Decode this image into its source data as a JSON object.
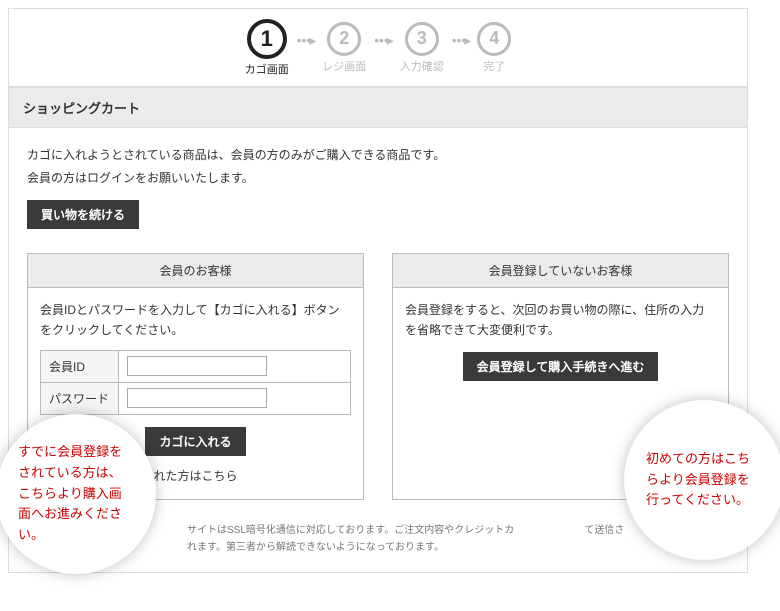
{
  "steps": {
    "s1": {
      "num": "1",
      "label": "カゴ画面"
    },
    "s2": {
      "num": "2",
      "label": "レジ画面"
    },
    "s3": {
      "num": "3",
      "label": "入力確認"
    },
    "s4": {
      "num": "4",
      "label": "完了"
    }
  },
  "page_title": "ショッピングカート",
  "notice_line1": "カゴに入れようとされている商品は、会員の方のみがご購入できる商品です。",
  "notice_line2": "会員の方はログインをお願いいたします。",
  "continue_shopping": "買い物を続ける",
  "member_box": {
    "header": "会員のお客様",
    "desc": "会員IDとパスワードを入力して【カゴに入れる】ボタンをクリックしてください。",
    "id_label": "会員ID",
    "pw_label": "パスワード",
    "submit": "カゴに入れる",
    "forgot": "れた方はこちら"
  },
  "nonmember_box": {
    "header": "会員登録していないお客様",
    "desc": "会員登録をすると、次回のお買い物の際に、住所の入力を省略できて大変便利です。",
    "submit": "会員登録して購入手続きへ進む"
  },
  "ssl_text": "サイトはSSL暗号化通信に対応しております。ご注文内容やクレジットカ　　　　　　　て送信されます。第三者から解読できないようになっております。",
  "bubble_left": "すでに会員登録をされている方は、こちらより購入画面へお進みください。",
  "bubble_right": "初めての方はこちらより会員登録を行ってください。"
}
